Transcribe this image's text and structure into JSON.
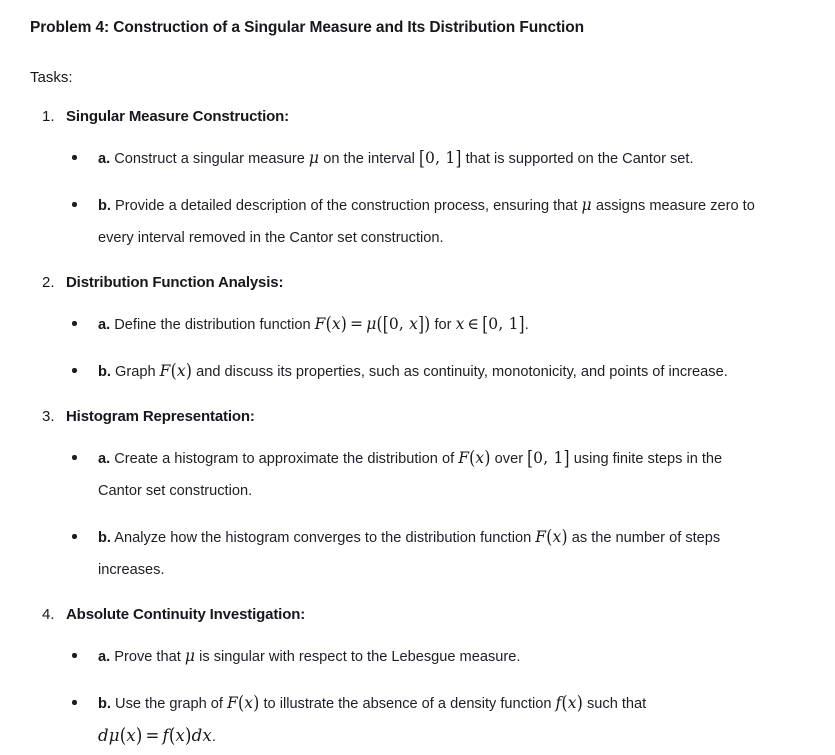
{
  "document": {
    "title": "Problem 4: Construction of a Singular Measure and Its Distribution Function",
    "tasks_label": "Tasks:"
  },
  "tasks": [
    {
      "number": "1.",
      "heading": "Singular Measure Construction:",
      "items": [
        {
          "label": "a.",
          "text_1": "Construct a singular measure ",
          "math_1": "μ",
          "text_2": " on the interval ",
          "math_2": "[0, 1]",
          "text_3": " that is supported on the Cantor set."
        },
        {
          "label": "b.",
          "text_1": "Provide a detailed description of the construction process, ensuring that ",
          "math_1": "μ",
          "text_2": " assigns measure zero to every interval removed in the Cantor set construction.",
          "math_2": "",
          "text_3": ""
        }
      ]
    },
    {
      "number": "2.",
      "heading": "Distribution Function Analysis:",
      "items": [
        {
          "label": "a.",
          "text_1": "Define the distribution function ",
          "math_1": "F(x) = μ([0, x])",
          "text_2": " for ",
          "math_2": "x ∈ [0, 1]",
          "text_3": "."
        },
        {
          "label": "b.",
          "text_1": "Graph ",
          "math_1": "F(x)",
          "text_2": " and discuss its properties, such as continuity, monotonicity, and points of increase.",
          "math_2": "",
          "text_3": ""
        }
      ]
    },
    {
      "number": "3.",
      "heading": "Histogram Representation:",
      "items": [
        {
          "label": "a.",
          "text_1": "Create a histogram to approximate the distribution of ",
          "math_1": "F(x)",
          "text_2": " over ",
          "math_2": "[0, 1]",
          "text_3": " using finite steps in the Cantor set construction."
        },
        {
          "label": "b.",
          "text_1": "Analyze how the histogram converges to the distribution function ",
          "math_1": "F(x)",
          "text_2": " as the number of steps increases.",
          "math_2": "",
          "text_3": ""
        }
      ]
    },
    {
      "number": "4.",
      "heading": "Absolute Continuity Investigation:",
      "items": [
        {
          "label": "a.",
          "text_1": "Prove that ",
          "math_1": "μ",
          "text_2": " is singular with respect to the Lebesgue measure.",
          "math_2": "",
          "text_3": ""
        },
        {
          "label": "b.",
          "text_1": "Use the graph of ",
          "math_1": "F(x)",
          "text_2": " to illustrate the absence of a density function ",
          "math_2": "f(x)",
          "text_3": " such that ",
          "math_3": "dμ(x) = f(x)dx",
          "text_4": "."
        }
      ]
    }
  ],
  "colors": {
    "background": "#ffffff",
    "text": "#1c1c24",
    "heading": "#17171f"
  }
}
